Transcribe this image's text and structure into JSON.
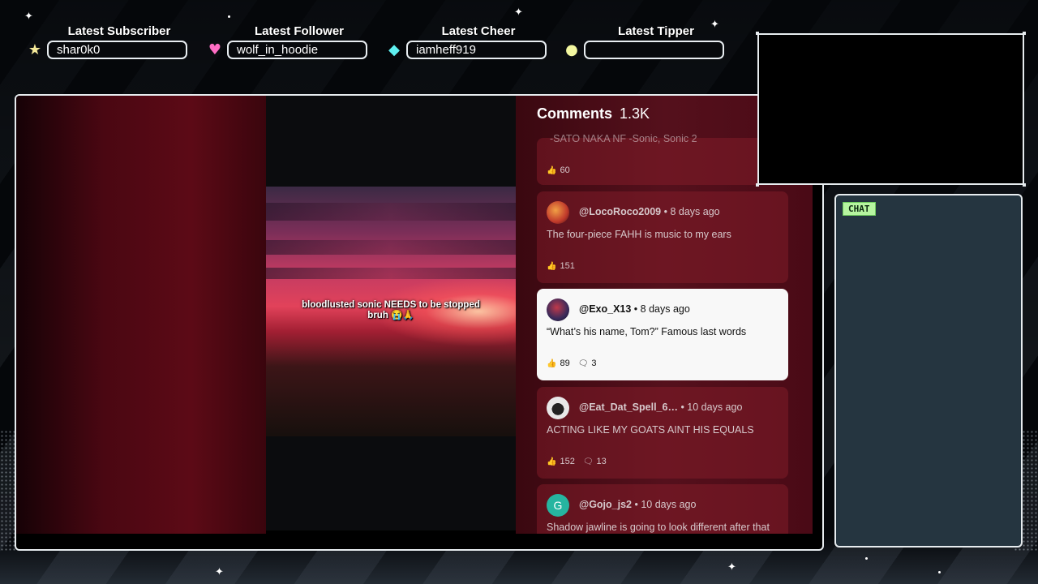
{
  "stats": [
    {
      "label": "Latest Subscriber",
      "value": "shar0k0",
      "icon": "star-icon",
      "icon_color": "#f6ea9a"
    },
    {
      "label": "Latest Follower",
      "value": "wolf_in_hoodie",
      "icon": "heart-icon",
      "icon_color": "#ff6ec4"
    },
    {
      "label": "Latest Cheer",
      "value": "iamheff919",
      "icon": "gem-icon",
      "icon_color": "#5ff0f0"
    },
    {
      "label": "Latest Tipper",
      "value": "",
      "icon": "coin-icon",
      "icon_color": "#f3f7a0"
    }
  ],
  "video": {
    "caption": "bloodlusted sonic NEEDS to be stopped bruh 😭🙏"
  },
  "comments": {
    "title": "Comments",
    "count": "1.3K",
    "items": [
      {
        "author": "",
        "time": "",
        "text": "-SATO NAKA NF -Sonic, Sonic 2",
        "likes": "60",
        "replies": "",
        "avatar_color": "#000000"
      },
      {
        "author": "@LocoRoco2009",
        "time": "8 days ago",
        "text": "The four-piece FAHH is music to my ears",
        "likes": "151",
        "replies": "",
        "avatar_color": "#c0392b"
      },
      {
        "author": "@Exo_X13",
        "time": "8 days ago",
        "text": "“What’s his name, Tom?” Famous last words",
        "likes": "89",
        "replies": "3",
        "avatar_color": "#3a2a5a"
      },
      {
        "author": "@Eat_Dat_Spell_6…",
        "time": "10 days ago",
        "text": "ACTING LIKE MY GOATS AINT HIS EQUALS",
        "likes": "152",
        "replies": "13",
        "avatar_color": "#e8e8e8"
      },
      {
        "author": "@Gojo_js2",
        "time": "10 days ago",
        "text": "Shadow jawline is going to look different after that",
        "likes": "",
        "replies": "",
        "avatar_color": "#26b5a0",
        "avatar_letter": "G"
      }
    ]
  },
  "chat": {
    "label": "CHAT"
  },
  "colors": {
    "frame_border": "#e7ecef",
    "chat_bg": "#253540",
    "chat_label_bg": "#b7f5a0"
  }
}
